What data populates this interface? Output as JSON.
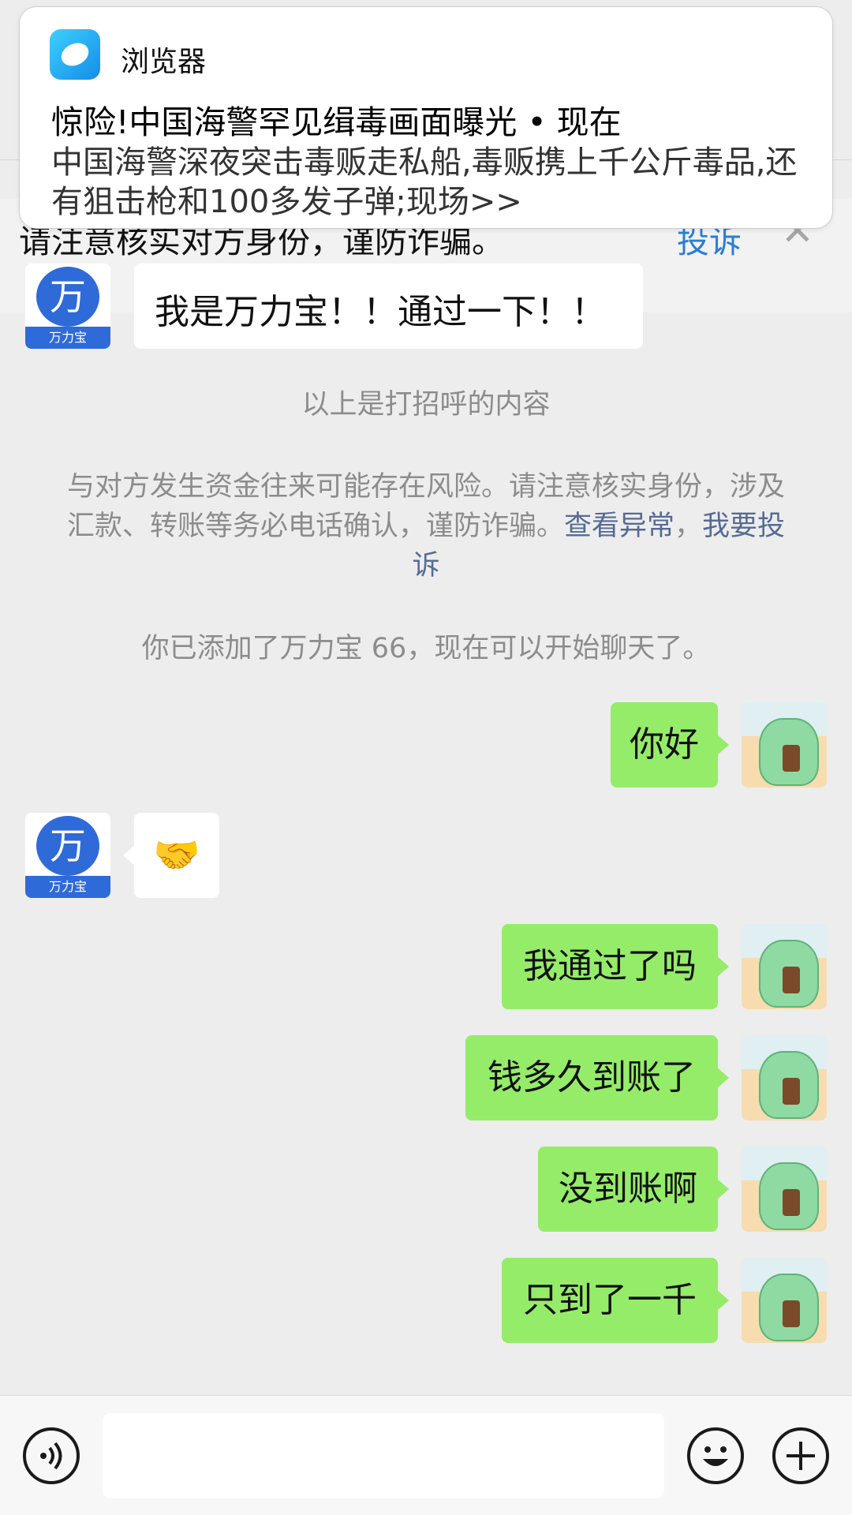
{
  "notification": {
    "app_name": "浏览器",
    "title": "惊险!中国海警罕见缉毒画面曝光 • 现在",
    "body": "中国海警深夜突击毒贩走私船,毒贩携上千公斤毒品,还有狙击枪和100多发子弹;现场>>"
  },
  "warning_banner": {
    "text": "请注意核实对方身份，谨防诈骗。",
    "report_link": "投诉",
    "close_icon": "close-icon"
  },
  "greeting_message": {
    "sender_avatar": "万力宝",
    "text": "我是万力宝！！通过一下！！"
  },
  "system": {
    "greeting_note": "以上是打招呼的内容",
    "risk_notice": "与对方发生资金往来可能存在风险。请注意核实身份，涉及汇款、转账等务必电话确认，谨防诈骗。",
    "risk_link_view": "查看异常",
    "risk_sep": "，",
    "risk_link_report": "我要投诉",
    "added_notice": "你已添加了万力宝 66，现在可以开始聊天了。"
  },
  "messages": [
    {
      "from": "me",
      "text": "你好"
    },
    {
      "from": "them",
      "text": "🤝"
    },
    {
      "from": "me",
      "text": "我通过了吗"
    },
    {
      "from": "me",
      "text": "钱多久到账了"
    },
    {
      "from": "me",
      "text": "没到账啊"
    },
    {
      "from": "me",
      "text": "只到了一千"
    }
  ],
  "input_bar": {
    "voice_icon": "voice-icon",
    "emoji_icon": "emoji-icon",
    "plus_icon": "plus-icon",
    "placeholder": ""
  }
}
